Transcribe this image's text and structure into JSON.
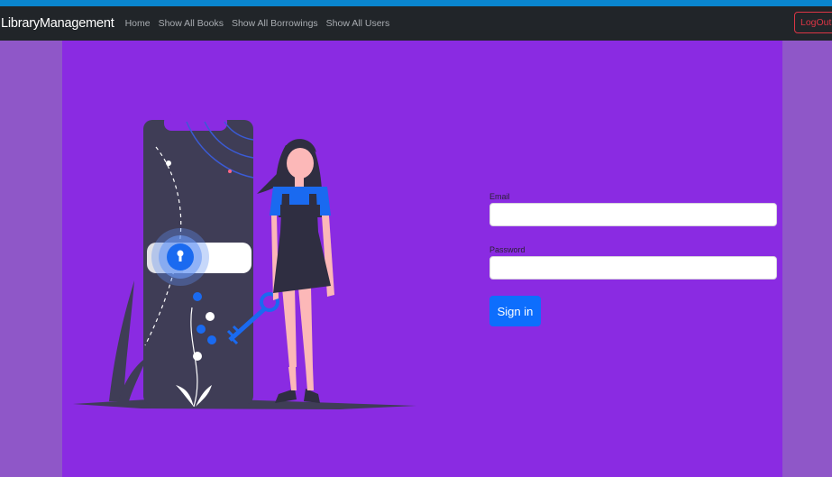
{
  "navbar": {
    "brand": "LibraryManagement",
    "links": [
      "Home",
      "Show All Books",
      "Show All Borrowings",
      "Show All Users"
    ],
    "logout_label": "LogOut"
  },
  "login_form": {
    "email_label": "Email",
    "email_value": "",
    "password_label": "Password",
    "password_value": "",
    "submit_label": "Sign in"
  },
  "illustration": {
    "icon": "unlock-illustration"
  },
  "colors": {
    "navbar_bg": "#212529",
    "main_bg": "#8a2be2",
    "side_bg": "#8f57c8",
    "primary": "#0d6efd",
    "danger": "#dc3545"
  }
}
